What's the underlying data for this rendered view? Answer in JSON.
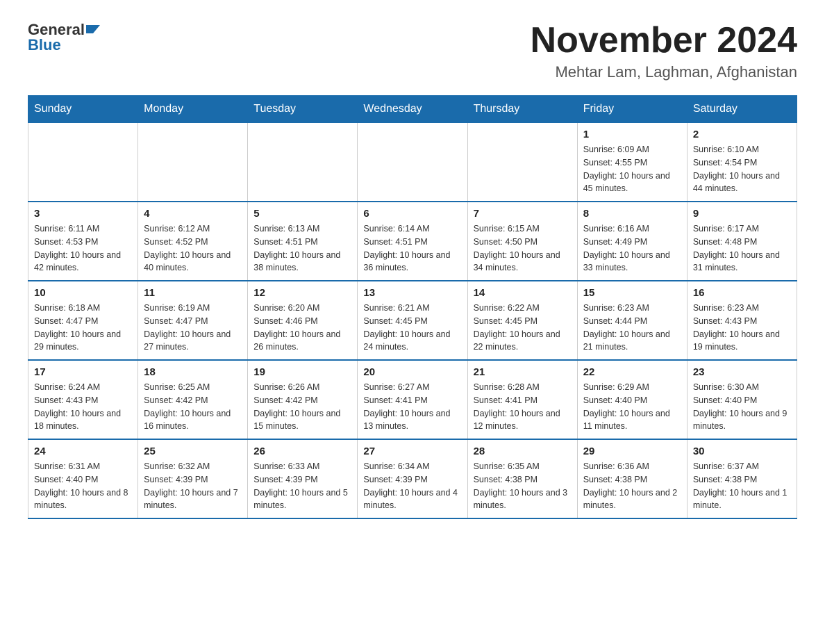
{
  "header": {
    "logo_text_general": "General",
    "logo_text_blue": "Blue",
    "main_title": "November 2024",
    "subtitle": "Mehtar Lam, Laghman, Afghanistan"
  },
  "days_of_week": [
    "Sunday",
    "Monday",
    "Tuesday",
    "Wednesday",
    "Thursday",
    "Friday",
    "Saturday"
  ],
  "weeks": [
    [
      {
        "day": "",
        "sunrise": "",
        "sunset": "",
        "daylight": ""
      },
      {
        "day": "",
        "sunrise": "",
        "sunset": "",
        "daylight": ""
      },
      {
        "day": "",
        "sunrise": "",
        "sunset": "",
        "daylight": ""
      },
      {
        "day": "",
        "sunrise": "",
        "sunset": "",
        "daylight": ""
      },
      {
        "day": "",
        "sunrise": "",
        "sunset": "",
        "daylight": ""
      },
      {
        "day": "1",
        "sunrise": "Sunrise: 6:09 AM",
        "sunset": "Sunset: 4:55 PM",
        "daylight": "Daylight: 10 hours and 45 minutes."
      },
      {
        "day": "2",
        "sunrise": "Sunrise: 6:10 AM",
        "sunset": "Sunset: 4:54 PM",
        "daylight": "Daylight: 10 hours and 44 minutes."
      }
    ],
    [
      {
        "day": "3",
        "sunrise": "Sunrise: 6:11 AM",
        "sunset": "Sunset: 4:53 PM",
        "daylight": "Daylight: 10 hours and 42 minutes."
      },
      {
        "day": "4",
        "sunrise": "Sunrise: 6:12 AM",
        "sunset": "Sunset: 4:52 PM",
        "daylight": "Daylight: 10 hours and 40 minutes."
      },
      {
        "day": "5",
        "sunrise": "Sunrise: 6:13 AM",
        "sunset": "Sunset: 4:51 PM",
        "daylight": "Daylight: 10 hours and 38 minutes."
      },
      {
        "day": "6",
        "sunrise": "Sunrise: 6:14 AM",
        "sunset": "Sunset: 4:51 PM",
        "daylight": "Daylight: 10 hours and 36 minutes."
      },
      {
        "day": "7",
        "sunrise": "Sunrise: 6:15 AM",
        "sunset": "Sunset: 4:50 PM",
        "daylight": "Daylight: 10 hours and 34 minutes."
      },
      {
        "day": "8",
        "sunrise": "Sunrise: 6:16 AM",
        "sunset": "Sunset: 4:49 PM",
        "daylight": "Daylight: 10 hours and 33 minutes."
      },
      {
        "day": "9",
        "sunrise": "Sunrise: 6:17 AM",
        "sunset": "Sunset: 4:48 PM",
        "daylight": "Daylight: 10 hours and 31 minutes."
      }
    ],
    [
      {
        "day": "10",
        "sunrise": "Sunrise: 6:18 AM",
        "sunset": "Sunset: 4:47 PM",
        "daylight": "Daylight: 10 hours and 29 minutes."
      },
      {
        "day": "11",
        "sunrise": "Sunrise: 6:19 AM",
        "sunset": "Sunset: 4:47 PM",
        "daylight": "Daylight: 10 hours and 27 minutes."
      },
      {
        "day": "12",
        "sunrise": "Sunrise: 6:20 AM",
        "sunset": "Sunset: 4:46 PM",
        "daylight": "Daylight: 10 hours and 26 minutes."
      },
      {
        "day": "13",
        "sunrise": "Sunrise: 6:21 AM",
        "sunset": "Sunset: 4:45 PM",
        "daylight": "Daylight: 10 hours and 24 minutes."
      },
      {
        "day": "14",
        "sunrise": "Sunrise: 6:22 AM",
        "sunset": "Sunset: 4:45 PM",
        "daylight": "Daylight: 10 hours and 22 minutes."
      },
      {
        "day": "15",
        "sunrise": "Sunrise: 6:23 AM",
        "sunset": "Sunset: 4:44 PM",
        "daylight": "Daylight: 10 hours and 21 minutes."
      },
      {
        "day": "16",
        "sunrise": "Sunrise: 6:23 AM",
        "sunset": "Sunset: 4:43 PM",
        "daylight": "Daylight: 10 hours and 19 minutes."
      }
    ],
    [
      {
        "day": "17",
        "sunrise": "Sunrise: 6:24 AM",
        "sunset": "Sunset: 4:43 PM",
        "daylight": "Daylight: 10 hours and 18 minutes."
      },
      {
        "day": "18",
        "sunrise": "Sunrise: 6:25 AM",
        "sunset": "Sunset: 4:42 PM",
        "daylight": "Daylight: 10 hours and 16 minutes."
      },
      {
        "day": "19",
        "sunrise": "Sunrise: 6:26 AM",
        "sunset": "Sunset: 4:42 PM",
        "daylight": "Daylight: 10 hours and 15 minutes."
      },
      {
        "day": "20",
        "sunrise": "Sunrise: 6:27 AM",
        "sunset": "Sunset: 4:41 PM",
        "daylight": "Daylight: 10 hours and 13 minutes."
      },
      {
        "day": "21",
        "sunrise": "Sunrise: 6:28 AM",
        "sunset": "Sunset: 4:41 PM",
        "daylight": "Daylight: 10 hours and 12 minutes."
      },
      {
        "day": "22",
        "sunrise": "Sunrise: 6:29 AM",
        "sunset": "Sunset: 4:40 PM",
        "daylight": "Daylight: 10 hours and 11 minutes."
      },
      {
        "day": "23",
        "sunrise": "Sunrise: 6:30 AM",
        "sunset": "Sunset: 4:40 PM",
        "daylight": "Daylight: 10 hours and 9 minutes."
      }
    ],
    [
      {
        "day": "24",
        "sunrise": "Sunrise: 6:31 AM",
        "sunset": "Sunset: 4:40 PM",
        "daylight": "Daylight: 10 hours and 8 minutes."
      },
      {
        "day": "25",
        "sunrise": "Sunrise: 6:32 AM",
        "sunset": "Sunset: 4:39 PM",
        "daylight": "Daylight: 10 hours and 7 minutes."
      },
      {
        "day": "26",
        "sunrise": "Sunrise: 6:33 AM",
        "sunset": "Sunset: 4:39 PM",
        "daylight": "Daylight: 10 hours and 5 minutes."
      },
      {
        "day": "27",
        "sunrise": "Sunrise: 6:34 AM",
        "sunset": "Sunset: 4:39 PM",
        "daylight": "Daylight: 10 hours and 4 minutes."
      },
      {
        "day": "28",
        "sunrise": "Sunrise: 6:35 AM",
        "sunset": "Sunset: 4:38 PM",
        "daylight": "Daylight: 10 hours and 3 minutes."
      },
      {
        "day": "29",
        "sunrise": "Sunrise: 6:36 AM",
        "sunset": "Sunset: 4:38 PM",
        "daylight": "Daylight: 10 hours and 2 minutes."
      },
      {
        "day": "30",
        "sunrise": "Sunrise: 6:37 AM",
        "sunset": "Sunset: 4:38 PM",
        "daylight": "Daylight: 10 hours and 1 minute."
      }
    ]
  ]
}
